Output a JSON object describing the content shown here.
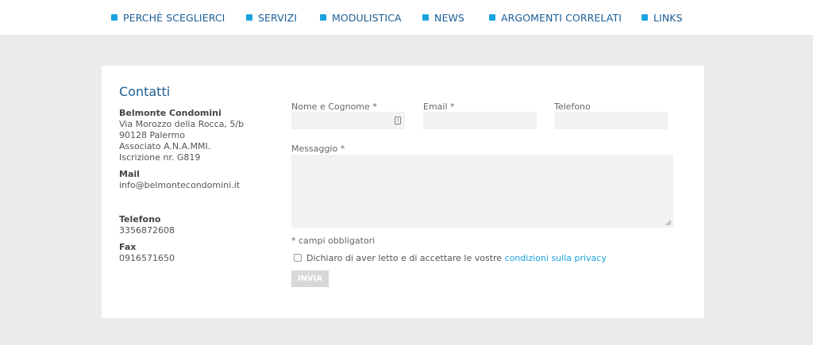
{
  "nav": {
    "items": [
      {
        "label": "PERCHÈ SCEGLIERCI"
      },
      {
        "label": "SERVIZI"
      },
      {
        "label": "MODULISTICA"
      },
      {
        "label": "NEWS"
      },
      {
        "label": "ARGOMENTI CORRELATI"
      },
      {
        "label": "LINKS"
      }
    ]
  },
  "contact": {
    "title": "Contatti",
    "company": "Belmonte Condomini",
    "address_line1": "Via Morozzo della Rocca, 5/b",
    "address_line2": "90128 Palermo",
    "association": "Associato A.N.A.MMI.",
    "registration": "Iscrizione nr. G819",
    "mail_label": "Mail",
    "mail_value": "info@belmontecondomini.it",
    "phone_label": "Telefono",
    "phone_value": "3356872608",
    "fax_label": "Fax",
    "fax_value": "0916571650"
  },
  "form": {
    "name_label": "Nome e Cognome *",
    "name_value": "",
    "email_label": "Email *",
    "email_value": "",
    "phone_label": "Telefono",
    "phone_value": "",
    "message_label": "Messaggio *",
    "message_value": "",
    "required_note": "* campi obbligatori",
    "consent_text": "Dichiaro di aver letto e di accettare le vostre ",
    "privacy_link": "condizioni sulla privacy",
    "consent_checked": false,
    "submit_label": "INVIA"
  },
  "colors": {
    "accent": "#1aa3de",
    "nav_text": "#1b5d96",
    "page_bg": "#ebebeb",
    "field_bg": "#f2f2f2",
    "button_disabled": "#d8d8d8"
  },
  "icons": {
    "nav_bullet": "square-bullet-icon",
    "autofill": "contact-card-icon",
    "resize": "resize-grip-icon"
  }
}
